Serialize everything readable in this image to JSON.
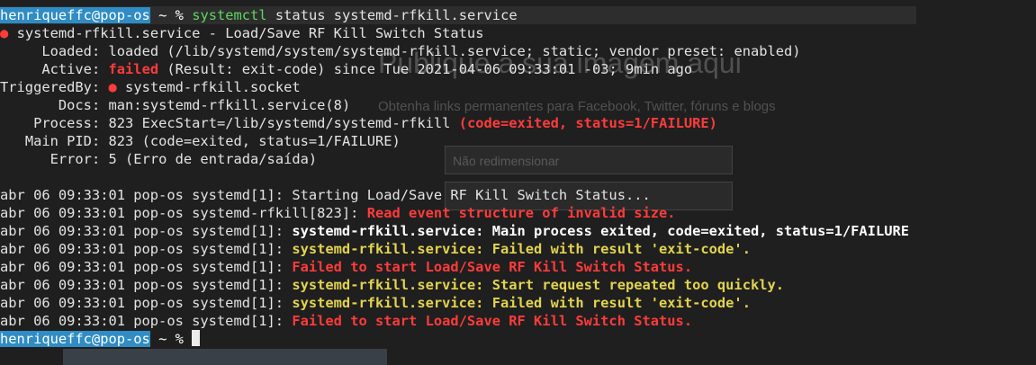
{
  "background_page": {
    "heading": "Publique a sua imagem aqui",
    "subtitle": "Obtenha links permanentes para Facebook, Twitter, fóruns e blogs",
    "select_resize": "Não redimensionar"
  },
  "prompt": {
    "user_host": "henriqueffc@pop-os",
    "path": "~",
    "symbol": "%",
    "command_name": "systemctl",
    "command_args": "status systemd-rfkill.service"
  },
  "status": {
    "dot": "●",
    "unit_line": "systemd-rfkill.service - Load/Save RF Kill Switch Status",
    "loaded_label": "Loaded:",
    "loaded_value": "loaded (/lib/systemd/system/systemd-rfkill.service; static; vendor preset: enabled)",
    "active_label": "Active:",
    "active_state": "failed",
    "active_rest": "(Result: exit-code) since Tue 2021-04-06 09:33:01 -03; 9min ago",
    "triggeredby_label": "TriggeredBy:",
    "triggeredby_value": "systemd-rfkill.socket",
    "docs_label": "Docs:",
    "docs_value": "man:systemd-rfkill.service(8)",
    "process_label": "Process:",
    "process_value": "823 ExecStart=/lib/systemd/systemd-rfkill",
    "process_error": "(code=exited, status=1/FAILURE)",
    "mainpid_label": "Main PID:",
    "mainpid_value": "823 (code=exited, status=1/FAILURE)",
    "error_label": "Error:",
    "error_value": "5 (Erro de entrada/saída)"
  },
  "log": [
    {
      "prefix": "abr 06 09:33:01 pop-os systemd[1]:",
      "message": "Starting Load/Save RF Kill Switch Status...",
      "style": "normal"
    },
    {
      "prefix": "abr 06 09:33:01 pop-os systemd-rfkill[823]:",
      "message": "Read event structure of invalid size.",
      "style": "error"
    },
    {
      "prefix": "abr 06 09:33:01 pop-os systemd[1]:",
      "message": "systemd-rfkill.service: Main process exited, code=exited, status=1/FAILURE",
      "style": "bold"
    },
    {
      "prefix": "abr 06 09:33:01 pop-os systemd[1]:",
      "message": "systemd-rfkill.service: Failed with result 'exit-code'.",
      "style": "warning"
    },
    {
      "prefix": "abr 06 09:33:01 pop-os systemd[1]:",
      "message": "Failed to start Load/Save RF Kill Switch Status.",
      "style": "error"
    },
    {
      "prefix": "abr 06 09:33:01 pop-os systemd[1]:",
      "message": "systemd-rfkill.service: Start request repeated too quickly.",
      "style": "warning"
    },
    {
      "prefix": "abr 06 09:33:01 pop-os systemd[1]:",
      "message": "systemd-rfkill.service: Failed with result 'exit-code'.",
      "style": "warning"
    },
    {
      "prefix": "abr 06 09:33:01 pop-os systemd[1]:",
      "message": "Failed to start Load/Save RF Kill Switch Status.",
      "style": "error"
    }
  ],
  "colors": {
    "prompt_user_bg": "#2f8cc4",
    "command": "#5fd75f",
    "error": "#ff3b3b",
    "warning": "#e2d34f",
    "terminal_bg": "#1e1e1e"
  }
}
